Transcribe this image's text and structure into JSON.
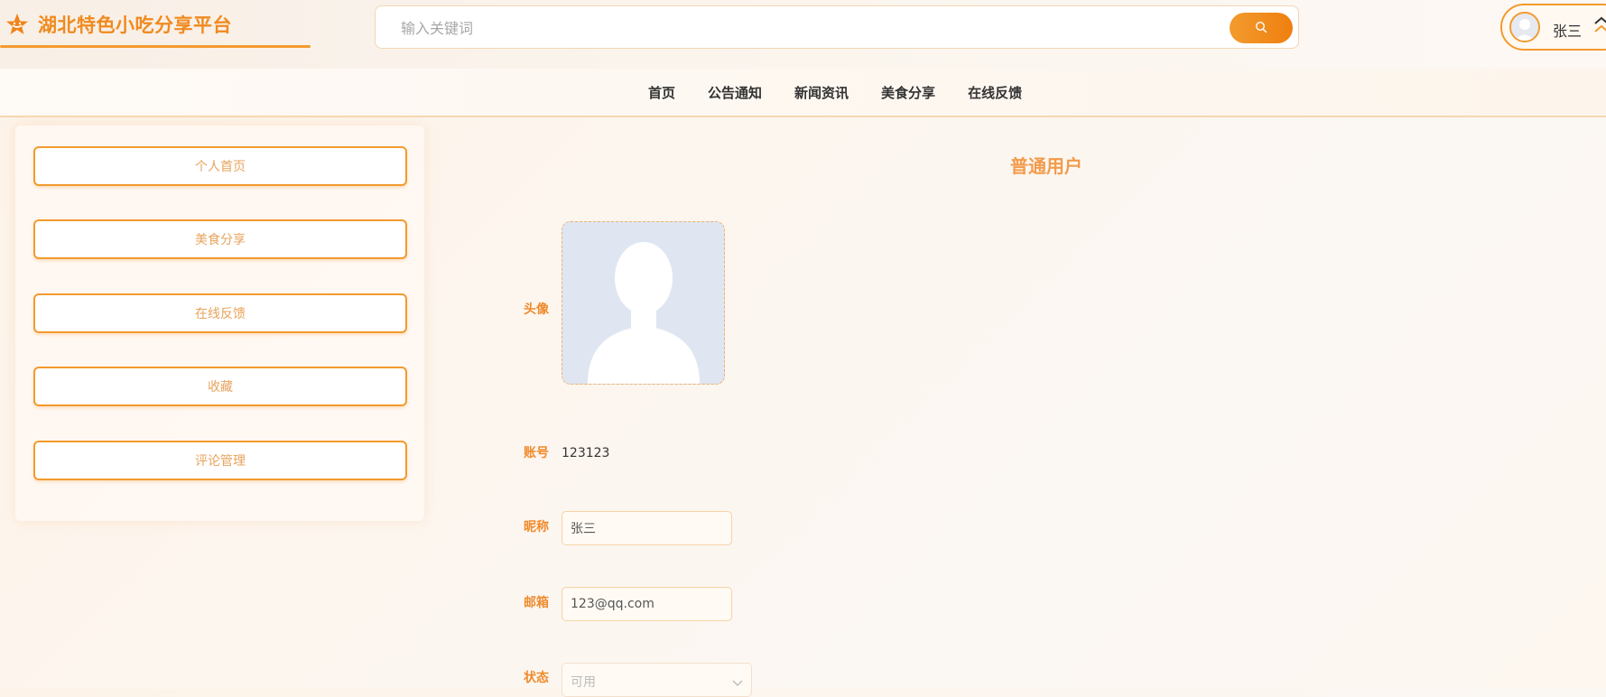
{
  "header": {
    "site_title": "湖北特色小吃分享平台",
    "search": {
      "placeholder": "输入关键词",
      "value": ""
    },
    "search_icon": "search-icon",
    "user": {
      "name": "张三",
      "avatar_icon": "user-avatar-icon",
      "menu_icon": "chevron-up-icon"
    }
  },
  "nav": {
    "items": [
      {
        "label": "首页"
      },
      {
        "label": "公告通知"
      },
      {
        "label": "新闻资讯"
      },
      {
        "label": "美食分享"
      },
      {
        "label": "在线反馈"
      }
    ]
  },
  "sidebar": {
    "items": [
      {
        "label": "个人首页"
      },
      {
        "label": "美食分享"
      },
      {
        "label": "在线反馈"
      },
      {
        "label": "收藏"
      },
      {
        "label": "评论管理"
      }
    ]
  },
  "profile": {
    "title": "普通用户",
    "avatar_label": "头像",
    "account_label": "账号",
    "account_value": "123123",
    "nickname_label": "昵称",
    "nickname_value": "张三",
    "email_label": "邮箱",
    "email_value": "123@qq.com",
    "status_label": "状态",
    "status_value": "可用"
  },
  "colors": {
    "accent": "#f39a2e",
    "accent_text": "#ef8b2d",
    "sidebar_text": "#e8a35c",
    "background": "#fdf5ec"
  }
}
